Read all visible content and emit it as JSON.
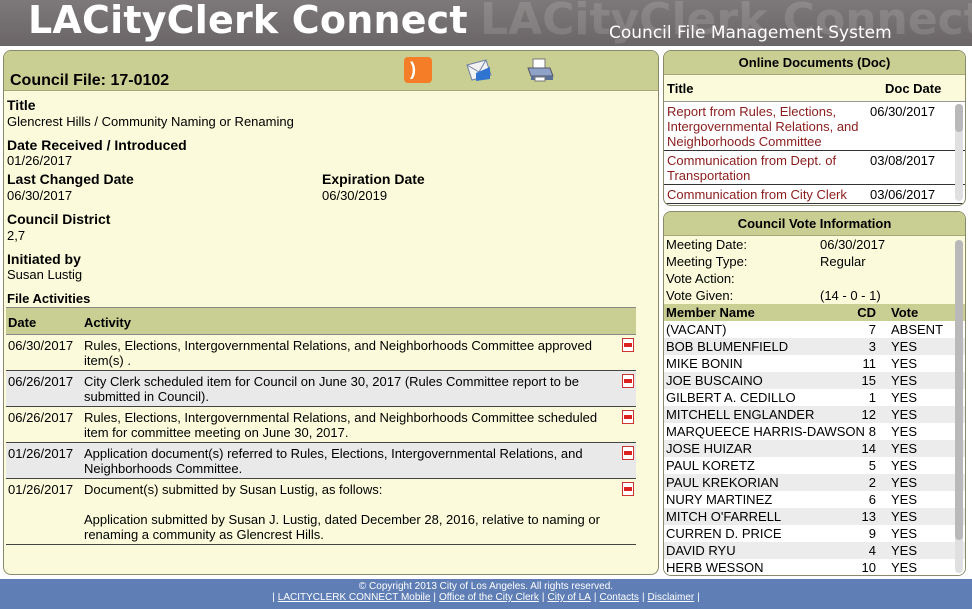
{
  "header": {
    "brand": "LACityClerk Connect",
    "ghost_text": "LACityClerk Connect",
    "subtitle": "Council File Management System"
  },
  "file": {
    "council_file_label": "Council File: 17-0102",
    "title_label": "Title",
    "title_value": "Glencrest Hills / Community Naming or Renaming",
    "date_received_label": "Date Received / Introduced",
    "date_received_value": "01/26/2017",
    "last_changed_label": "Last Changed Date",
    "last_changed_value": "06/30/2017",
    "expiration_label": "Expiration Date",
    "expiration_value": "06/30/2019",
    "district_label": "Council District",
    "district_value": "2,7",
    "initiated_label": "Initiated by",
    "initiated_value": "Susan Lustig",
    "activities_label": "File Activities"
  },
  "activities": {
    "col_date": "Date",
    "col_activity": "Activity",
    "rows": [
      {
        "date": "06/30/2017",
        "text": "Rules, Elections, Intergovernmental Relations, and Neighborhoods Committee approved item(s) ."
      },
      {
        "date": "06/26/2017",
        "text": "City Clerk scheduled item for Council on June 30, 2017 (Rules Committee report to be submitted in Council)."
      },
      {
        "date": "06/26/2017",
        "text": "Rules, Elections, Intergovernmental Relations, and Neighborhoods Committee scheduled item for committee meeting on June 30, 2017."
      },
      {
        "date": "01/26/2017",
        "text": "Application document(s) referred to Rules, Elections, Intergovernmental Relations, and Neighborhoods Committee."
      },
      {
        "date": "01/26/2017",
        "text": "Document(s) submitted by Susan Lustig, as follows:",
        "extra": "Application submitted by Susan J. Lustig, dated December 28, 2016, relative to naming or renaming a community as Glencrest Hills."
      }
    ]
  },
  "online_docs": {
    "heading": "Online Documents (Doc)",
    "col_title": "Title",
    "col_date": "Doc Date",
    "rows": [
      {
        "title": "Report from Rules, Elections, Intergovernmental Relations, and Neighborhoods Committee",
        "date": "06/30/2017"
      },
      {
        "title": "Communication from Dept. of Transportation",
        "date": "03/08/2017"
      },
      {
        "title": "Communication from City Clerk",
        "date": "03/06/2017"
      }
    ]
  },
  "vote": {
    "heading": "Council Vote Information",
    "meeting_date_label": "Meeting Date:",
    "meeting_date": "06/30/2017",
    "meeting_type_label": "Meeting Type:",
    "meeting_type": "Regular",
    "vote_action_label": "Vote Action:",
    "vote_action": "",
    "vote_given_label": "Vote Given:",
    "vote_given": "(14 - 0 - 1)",
    "col_member": "Member Name",
    "col_cd": "CD",
    "col_vote": "Vote",
    "members": [
      {
        "name": " (VACANT)",
        "cd": "7",
        "vote": "ABSENT"
      },
      {
        "name": "BOB BLUMENFIELD",
        "cd": "3",
        "vote": "YES"
      },
      {
        "name": "MIKE BONIN",
        "cd": "11",
        "vote": "YES"
      },
      {
        "name": "JOE BUSCAINO",
        "cd": "15",
        "vote": "YES"
      },
      {
        "name": "GILBERT A. CEDILLO",
        "cd": "1",
        "vote": "YES"
      },
      {
        "name": "MITCHELL ENGLANDER",
        "cd": "12",
        "vote": "YES"
      },
      {
        "name": "MARQUEECE HARRIS-DAWSON",
        "cd": "8",
        "vote": "YES"
      },
      {
        "name": "JOSE HUIZAR",
        "cd": "14",
        "vote": "YES"
      },
      {
        "name": "PAUL KORETZ",
        "cd": "5",
        "vote": "YES"
      },
      {
        "name": "PAUL KREKORIAN",
        "cd": "2",
        "vote": "YES"
      },
      {
        "name": "NURY MARTINEZ",
        "cd": "6",
        "vote": "YES"
      },
      {
        "name": "MITCH O'FARRELL",
        "cd": "13",
        "vote": "YES"
      },
      {
        "name": "CURREN D. PRICE",
        "cd": "9",
        "vote": "YES"
      },
      {
        "name": "DAVID RYU",
        "cd": "4",
        "vote": "YES"
      },
      {
        "name": "HERB WESSON",
        "cd": "10",
        "vote": "YES"
      }
    ]
  },
  "footer": {
    "copyright": "© Copyright 2013 City of Los Angeles. All rights reserved.",
    "links": [
      "LACITYCLERK CONNECT Mobile",
      "Office of the City Clerk",
      "City of LA",
      "Contacts",
      "Disclaimer"
    ]
  },
  "icons": {
    "rss": "rss-icon",
    "mail": "email-icon",
    "print": "printer-icon"
  },
  "colors": {
    "header_bg": "#6f6a6b",
    "panel_bg": "#fbfbdc",
    "accent_green": "#c9cf92",
    "doc_link": "#8b1c1c",
    "footer_bg": "#5e7eb5",
    "rss": "#f57d27"
  }
}
